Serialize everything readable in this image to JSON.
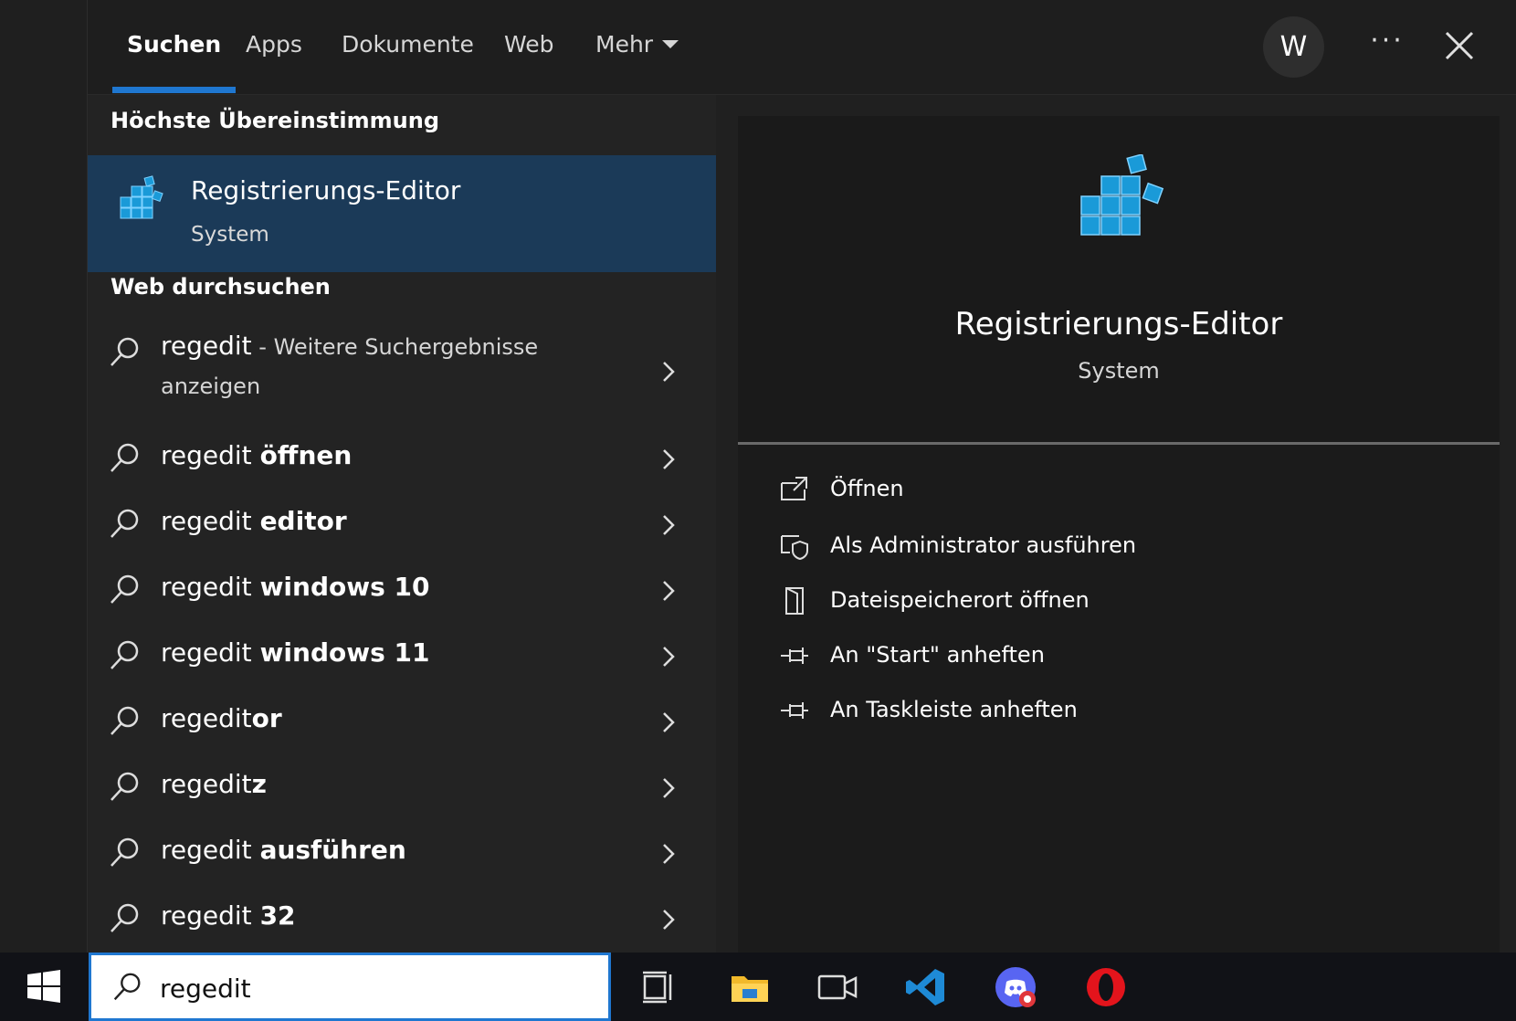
{
  "tabs": [
    {
      "label": "Suchen",
      "active": true
    },
    {
      "label": "Apps"
    },
    {
      "label": "Dokumente"
    },
    {
      "label": "Web"
    },
    {
      "label": "Mehr"
    }
  ],
  "header": {
    "avatar_letter": "W",
    "more": "···"
  },
  "results": {
    "best_match_heading": "Höchste Übereinstimmung",
    "best_match": {
      "title": "Registrierungs-Editor",
      "subtitle": "System"
    },
    "web_heading": "Web durchsuchen",
    "suggestions": [
      {
        "query": "regedit",
        "rest": " - Weitere Suchergebnisse anzeigen"
      },
      {
        "query": "regedit ",
        "bold": "öffnen"
      },
      {
        "query": "regedit ",
        "bold": "editor"
      },
      {
        "query": "regedit ",
        "bold": "windows 10"
      },
      {
        "query": "regedit ",
        "bold": "windows 11"
      },
      {
        "query": "regedit",
        "bold": "or"
      },
      {
        "query": "regedit",
        "bold": "z"
      },
      {
        "query": "regedit ",
        "bold": "ausführen"
      },
      {
        "query": "regedit ",
        "bold": "32"
      }
    ]
  },
  "preview": {
    "title": "Registrierungs-Editor",
    "subtitle": "System",
    "actions": [
      {
        "label": "Öffnen",
        "icon": "open-icon"
      },
      {
        "label": "Als Administrator ausführen",
        "icon": "shield-icon"
      },
      {
        "label": "Dateispeicherort öffnen",
        "icon": "file-location-icon"
      },
      {
        "label": "An \"Start\" anheften",
        "icon": "pin-icon"
      },
      {
        "label": "An Taskleiste anheften",
        "icon": "pin-icon"
      }
    ]
  },
  "taskbar": {
    "search_value": "regedit",
    "apps": [
      "task-view-icon",
      "file-explorer-icon",
      "teams-meet-icon",
      "vscode-icon",
      "discord-icon",
      "opera-icon"
    ]
  },
  "colors": {
    "accent": "#1f77d0",
    "selected": "#1b3a58",
    "panel": "#232323"
  }
}
